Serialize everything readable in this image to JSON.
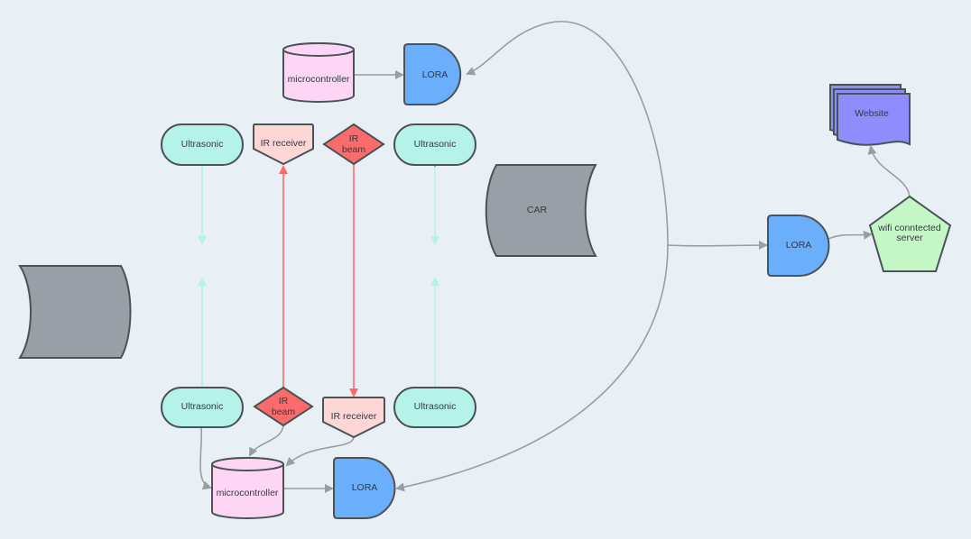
{
  "colors": {
    "background": "#e8f0f5",
    "microcontroller": "#fdd5f5",
    "lora": "#6aaefc",
    "ultrasonic": "#b5f3ea",
    "ir_receiver": "#fdd6d6",
    "ir_beam": "#fc6b6b",
    "car": "#999fa6",
    "server": "#c4f6c6",
    "website": "#8f8cfd",
    "connector": "#9a9ea2",
    "ir_line": "#fc6b6b",
    "ultrasonic_line": "#b5f3ea"
  },
  "nodes": {
    "top_microcontroller": "microcontroller",
    "top_lora": "LORA",
    "ultrasonic_tl": "Ultrasonic",
    "ir_receiver_top": "IR receiver",
    "ir_beam_top_1": "IR",
    "ir_beam_top_2": "beam",
    "ultrasonic_tr": "Ultrasonic",
    "car": "CAR",
    "ultrasonic_bl": "Ultrasonic",
    "ir_beam_bottom_1": "IR",
    "ir_beam_bottom_2": "beam",
    "ir_receiver_bottom": "IR receiver",
    "ultrasonic_br": "Ultrasonic",
    "bottom_microcontroller": "microcontroller",
    "bottom_lora": "LORA",
    "right_lora": "LORA",
    "server_1": "wifi conntected",
    "server_2": "server",
    "website": "Website"
  }
}
